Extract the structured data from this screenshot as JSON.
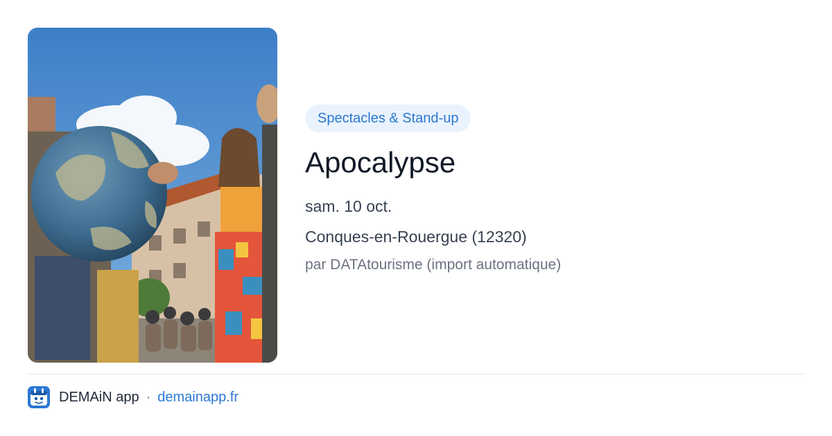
{
  "event": {
    "category": "Spectacles & Stand-up",
    "title": "Apocalypse",
    "date": "sam. 10 oct.",
    "location": "Conques-en-Rouergue (12320)",
    "source": "par DATAtourisme (import automatique)"
  },
  "footer": {
    "app_name": "DEMAiN app",
    "separator": "·",
    "site": "demainapp.fr"
  },
  "colors": {
    "accent": "#2b78d3",
    "tag_background": "#eaf3fd",
    "title": "#111827",
    "body": "#374151",
    "muted": "#6b7280"
  },
  "icons": {
    "logo": "demain-app-logo-icon"
  }
}
